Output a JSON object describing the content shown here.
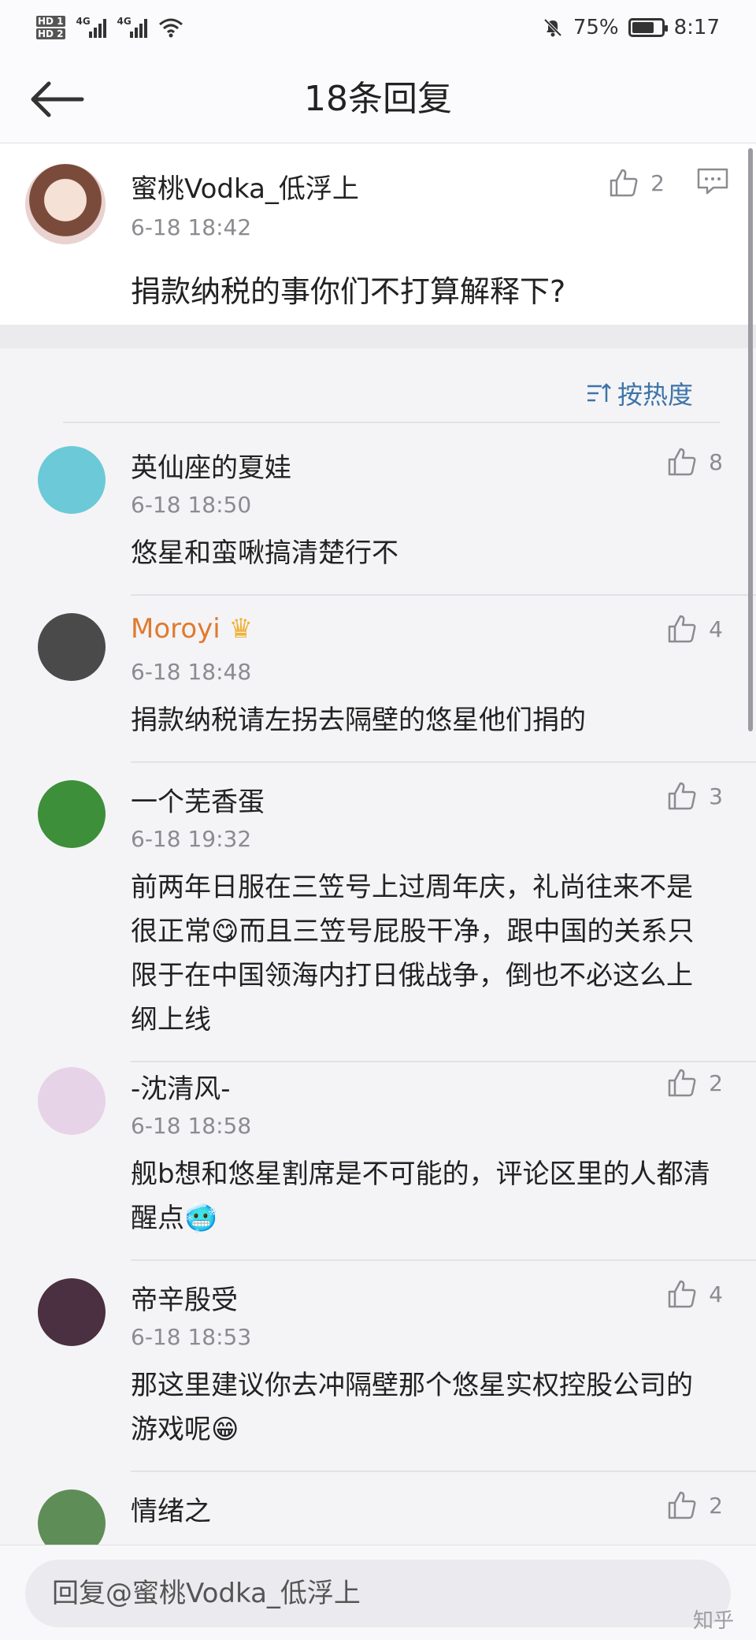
{
  "status_bar": {
    "sim1": "HD 1",
    "sim2": "HD 2",
    "network": "4G",
    "battery_percent": "75%",
    "battery_level": 0.75,
    "time": "8:17"
  },
  "header": {
    "title": "18条回复"
  },
  "root_comment": {
    "author": "蜜桃Vodka_低浮上",
    "time": "6-18 18:42",
    "text": "捐款纳税的事你们不打算解释下?",
    "likes": "2"
  },
  "sort": {
    "label": "按热度"
  },
  "replies": [
    {
      "author": "英仙座的夏娃",
      "time": "6-18 18:50",
      "text": "悠星和蛮啾搞清楚行不",
      "likes": "8",
      "avatar_color": "#6cc9d8"
    },
    {
      "author": "Moroyi",
      "time": "6-18 18:48",
      "text": "捐款纳税请左拐去隔壁的悠星他们捐的",
      "likes": "4",
      "avatar_color": "#4a4a4a",
      "name_color": "#e07a2e",
      "badge": "crown-icon"
    },
    {
      "author": "一个芜香蛋",
      "time": "6-18 19:32",
      "text": "前两年日服在三笠号上过周年庆，礼尚往来不是很正常😋而且三笠号屁股干净，跟中国的关系只限于在中国领海内打日俄战争，倒也不必这么上纲上线",
      "likes": "3",
      "avatar_color": "#3d8f3a"
    },
    {
      "author": "-沈清风-",
      "time": "6-18 18:58",
      "text": "舰b想和悠星割席是不可能的，评论区里的人都清醒点🥶",
      "likes": "2",
      "avatar_color": "#e7d3e7"
    },
    {
      "author": "帝辛殷受",
      "time": "6-18 18:53",
      "text": "那这里建议你去冲隔壁那个悠星实权控股公司的游戏呢😁",
      "likes": "4",
      "avatar_color": "#4a3040"
    },
    {
      "author": "情绪之",
      "time": "",
      "text": "",
      "likes": "2",
      "avatar_color": "#5f8d57"
    }
  ],
  "reply_input": {
    "placeholder": "回复@蜜桃Vodka_低浮上"
  },
  "watermark": "知乎"
}
